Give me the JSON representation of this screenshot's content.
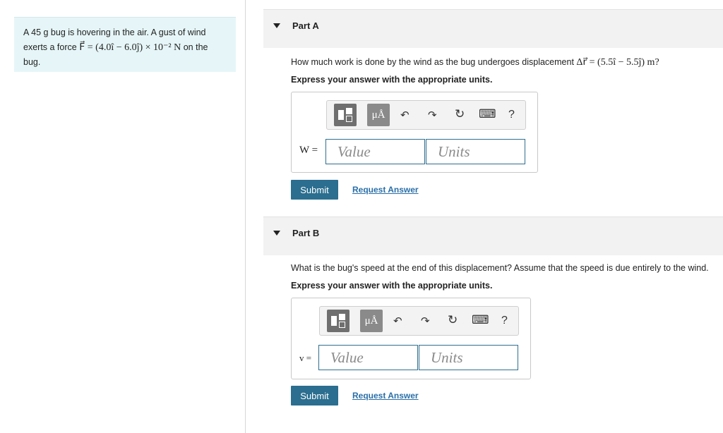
{
  "problem": {
    "text_before": "A 45 g bug is hovering in the air. A gust of wind exerts a force ",
    "force_expr": "F⃗ = (4.0î − 6.0ĵ) × 10⁻² N",
    "text_after": " on the bug."
  },
  "parts": [
    {
      "title": "Part A",
      "question_text": "How much work is done by the wind as the bug undergoes displacement ",
      "question_math": "Δr⃗ = (5.5î − 5.5ĵ) m?",
      "instruction": "Express your answer with the appropriate units.",
      "answer_label": "W =",
      "value_placeholder": "Value",
      "units_placeholder": "Units",
      "submit_label": "Submit",
      "request_label": "Request Answer"
    },
    {
      "title": "Part B",
      "question_text": "What is the bug's speed at the end of this displacement? Assume that the speed is due entirely to the wind.",
      "instruction": "Express your answer with the appropriate units.",
      "answer_label": "v =",
      "value_placeholder": "Value",
      "units_placeholder": "Units",
      "submit_label": "Submit",
      "request_label": "Request Answer"
    }
  ],
  "toolbar": {
    "units_button": "μÅ",
    "undo_icon": "↶",
    "redo_icon": "↷",
    "reset_icon": "↻",
    "keyboard_icon": "⌨",
    "help_icon": "?"
  },
  "colors": {
    "problem_bg": "#e6f6f8",
    "part_header_bg": "#f2f2f2",
    "submit_bg": "#2b6e8f",
    "link": "#2a6fa8",
    "field_border": "#2e6f8f"
  }
}
